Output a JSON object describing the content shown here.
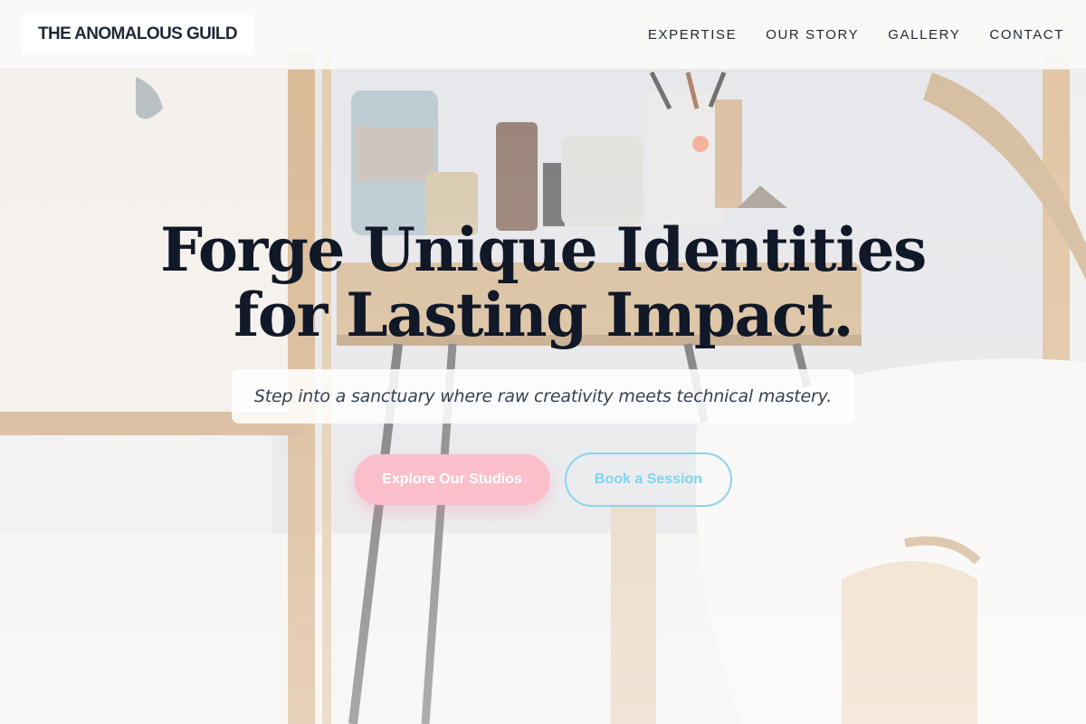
{
  "header": {
    "brand": "THE ANOMALOUS GUILD",
    "nav": [
      "EXPERTISE",
      "OUR STORY",
      "GALLERY",
      "CONTACT"
    ]
  },
  "hero": {
    "title_line1": "Forge Unique Identities",
    "title_line2": "for Lasting Impact.",
    "tagline": "Step into a sanctuary where raw creativity meets technical mastery.",
    "primary_cta": "Explore Our Studios",
    "secondary_cta": "Book a Session"
  },
  "colors": {
    "primary_button": "#fbbfcc",
    "secondary_button_border": "#8ad4ee",
    "title": "#111827"
  }
}
